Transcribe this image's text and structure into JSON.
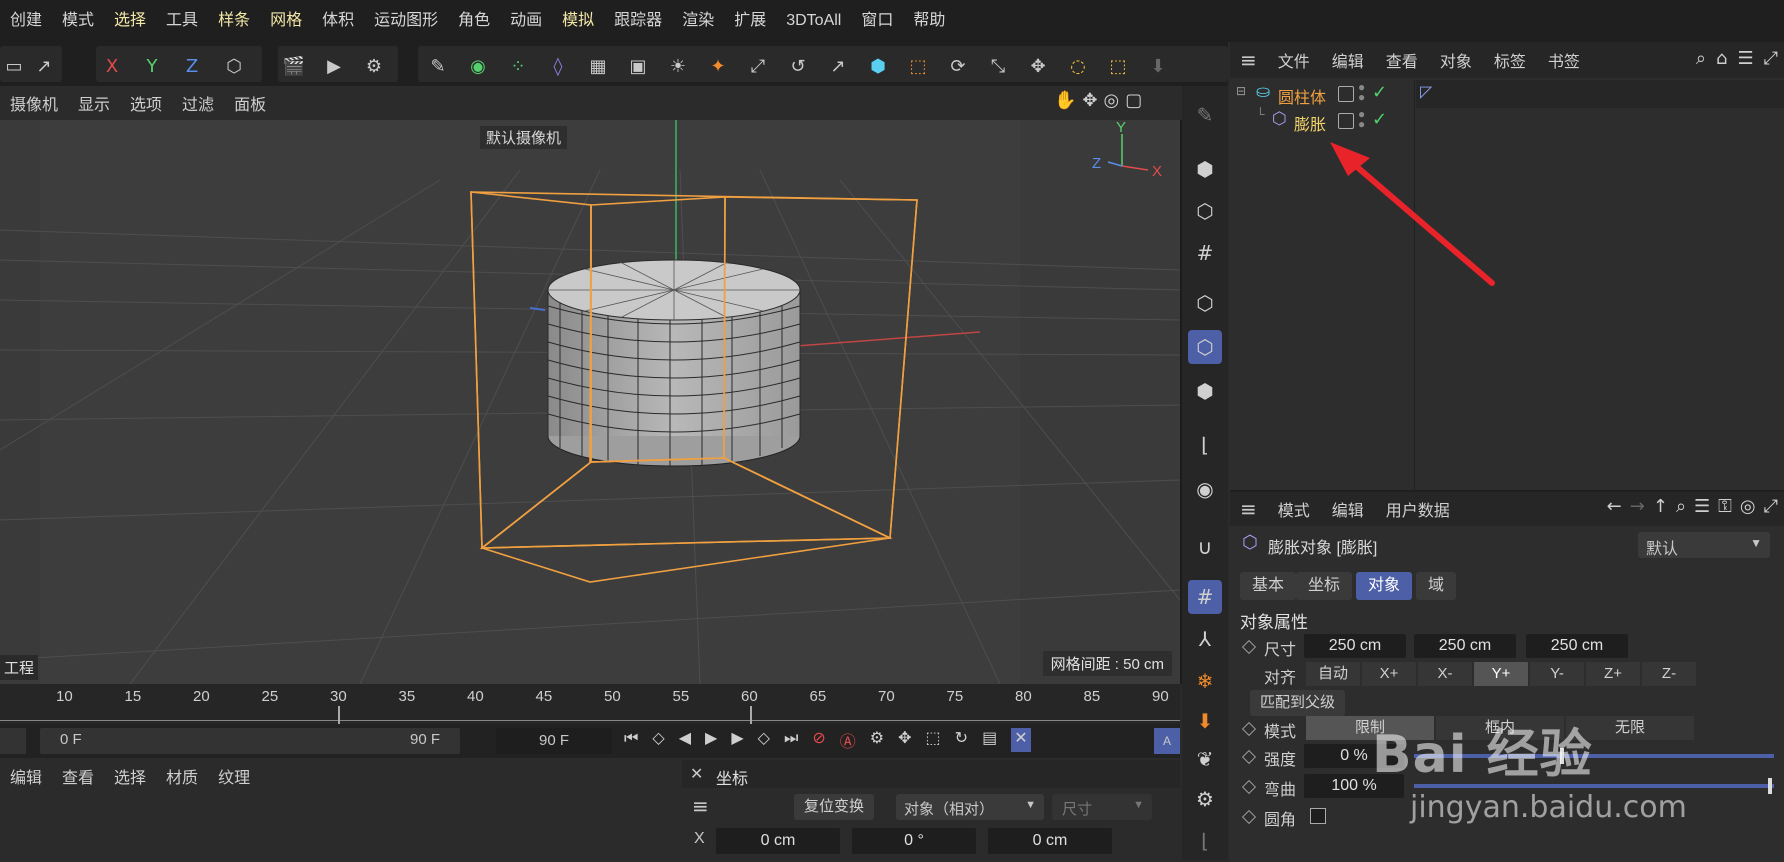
{
  "menubar": [
    "创建",
    "模式",
    "选择",
    "工具",
    "样条",
    "网格",
    "体积",
    "运动图形",
    "角色",
    "动画",
    "模拟",
    "跟踪器",
    "渲染",
    "扩展",
    "3DToAll",
    "窗口",
    "帮助"
  ],
  "menubar_highlight": [
    "选择",
    "样条",
    "网格",
    "模拟"
  ],
  "toolbar": {
    "x": "X",
    "y": "Y",
    "z": "Z"
  },
  "viewport_menu": [
    "摄像机",
    "显示",
    "选项",
    "过滤",
    "面板"
  ],
  "viewport": {
    "camera_label": "默认摄像机",
    "grid_spacing": "网格间距 : 50 cm",
    "project_label": "工程",
    "axis_y": "Y",
    "axis_z": "Z",
    "axis_x": "X"
  },
  "object_manager": {
    "menu": [
      "文件",
      "编辑",
      "查看",
      "对象",
      "标签",
      "书签"
    ],
    "objects": [
      {
        "name": "圆柱体",
        "color": "#f0a040"
      },
      {
        "name": "膨胀",
        "color": "#f2d36a"
      }
    ]
  },
  "attribute_manager": {
    "menu": [
      "模式",
      "编辑",
      "用户数据"
    ],
    "object_title": "膨胀对象 [膨胀]",
    "preset": "默认",
    "tabs": [
      "基本",
      "坐标",
      "对象",
      "域"
    ],
    "active_tab": "对象",
    "section": "对象属性",
    "size_label": "尺寸",
    "size": [
      "250 cm",
      "250 cm",
      "250 cm"
    ],
    "align_label": "对齐",
    "align_options": [
      "自动",
      "X+",
      "X-",
      "Y+",
      "Y-",
      "Z+",
      "Z-"
    ],
    "align_selected": "Y+",
    "fit_parent": "匹配到父级",
    "mode_label": "模式",
    "mode_options": [
      "限制",
      "框内",
      "无限"
    ],
    "strength_label": "强度",
    "strength": "0 %",
    "bend_label": "弯曲",
    "bend": "100 %",
    "round_label": "圆角"
  },
  "timeline": {
    "ticks": [
      "10",
      "15",
      "20",
      "25",
      "30",
      "35",
      "40",
      "45",
      "50",
      "55",
      "60",
      "65",
      "70",
      "75",
      "80",
      "85",
      "90"
    ],
    "start": "0 F",
    "end": "90 F",
    "end_field": "90 F"
  },
  "material_panel": {
    "menu": [
      "编辑",
      "查看",
      "选择",
      "材质",
      "纹理"
    ]
  },
  "coord_panel": {
    "title": "坐标",
    "reset": "复位变换",
    "mode": "对象（相对）",
    "size_dd": "尺寸",
    "x_label": "X",
    "values": [
      "0 cm",
      "0 °",
      "0 cm"
    ]
  },
  "watermark": {
    "brand": "Bai 经验",
    "url": "jingyan.baidu.com"
  },
  "colors": {
    "accent": "#4d5fa6",
    "selection_box": "#f0a040",
    "arrow": "#e8232a"
  }
}
